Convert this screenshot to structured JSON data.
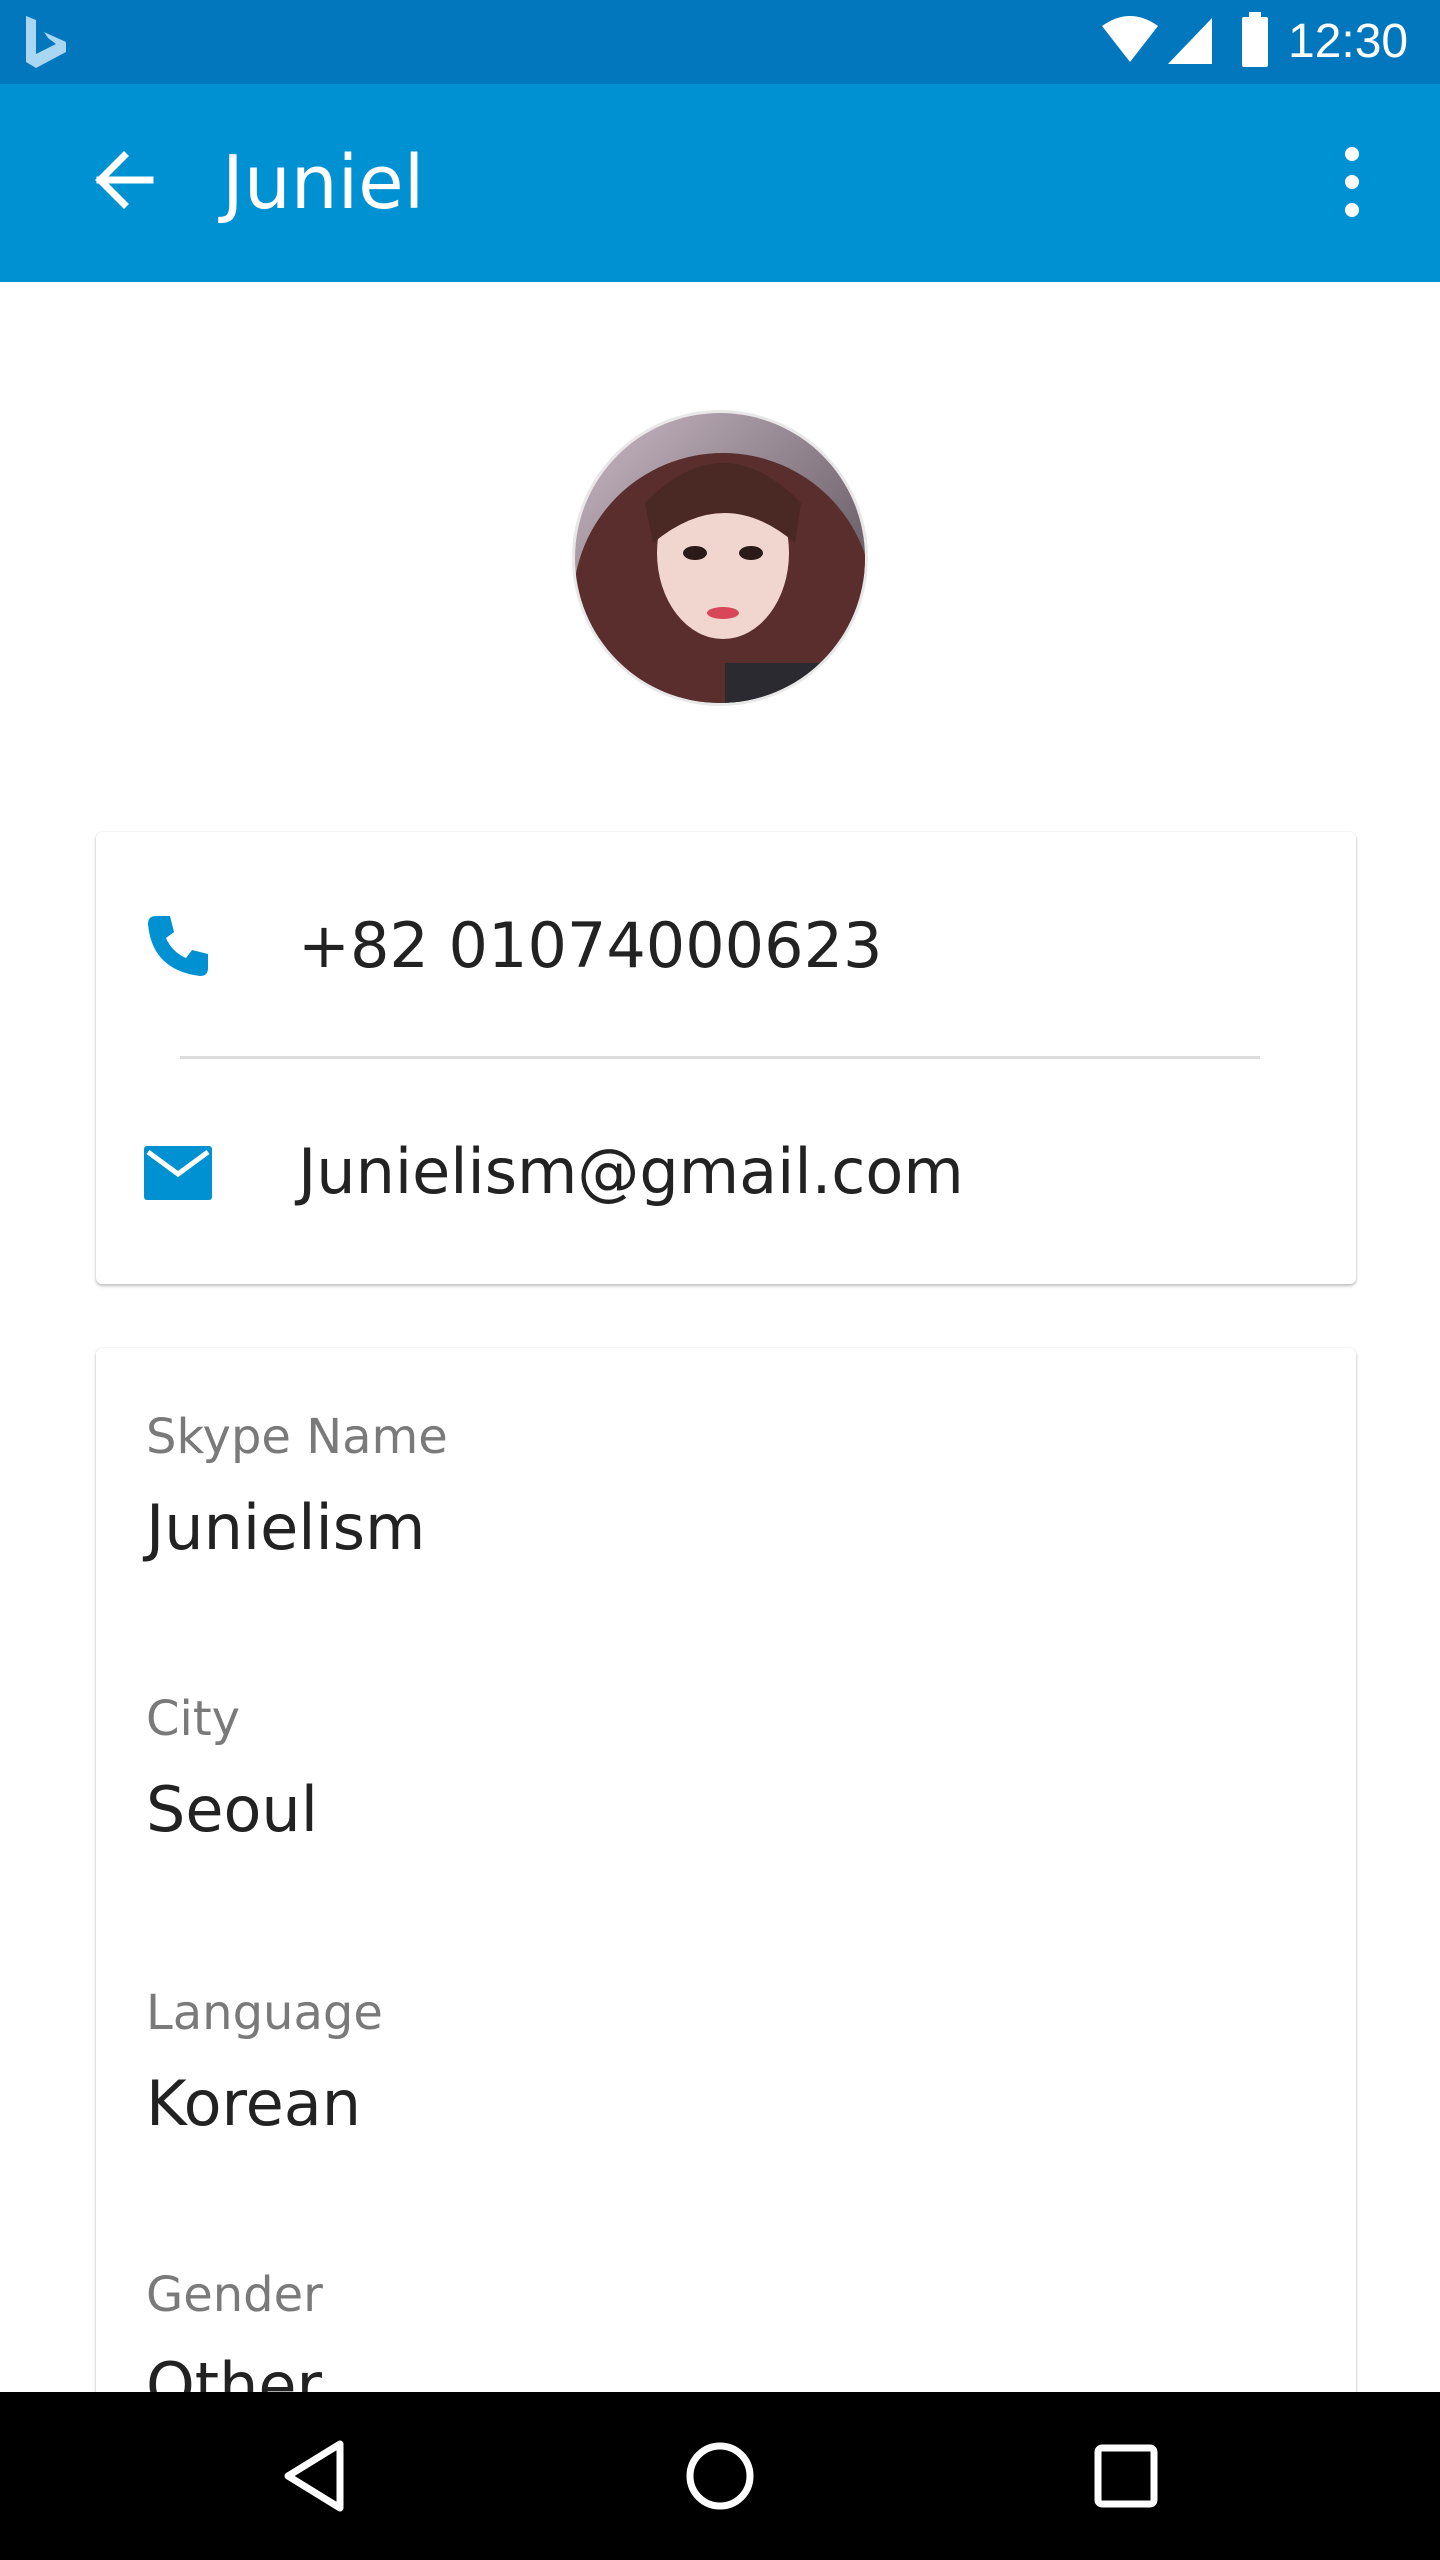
{
  "status_bar": {
    "time": "12:30",
    "icons": [
      "bing-icon",
      "wifi-icon",
      "signal-icon",
      "battery-icon"
    ]
  },
  "app_bar": {
    "title": "Juniel",
    "background": "#0091d2",
    "icons": [
      "back-arrow-icon",
      "more-vert-icon"
    ]
  },
  "contact": {
    "phone": "+82 01074000623",
    "email": "Junielism@gmail.com",
    "accent": "#0091d2"
  },
  "details": [
    {
      "label": "Skype Name",
      "value": "Junielism"
    },
    {
      "label": "City",
      "value": "Seoul"
    },
    {
      "label": "Language",
      "value": "Korean"
    },
    {
      "label": "Gender",
      "value": "Other"
    }
  ],
  "nav_bar": {
    "icons": [
      "back-triangle-icon",
      "home-circle-icon",
      "recents-square-icon"
    ]
  }
}
